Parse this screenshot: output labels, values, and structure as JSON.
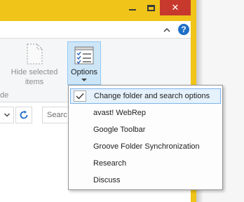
{
  "window": {
    "close_glyph": "✕"
  },
  "ribbon": {
    "help_glyph": "?",
    "hide_selected_label": "Hide selected items",
    "group_label": "de",
    "options_label": "Options"
  },
  "address_bar": {
    "search_placeholder": "Searc"
  },
  "menu": {
    "items": [
      {
        "label": "Change folder and search options",
        "checked": true,
        "selected": true
      },
      {
        "label": "avast! WebRep"
      },
      {
        "label": "Google Toolbar"
      },
      {
        "label": "Groove Folder Synchronization"
      },
      {
        "label": "Research"
      },
      {
        "label": "Discuss"
      }
    ]
  },
  "colors": {
    "frame": "#f0c419",
    "close_button": "#c7392c",
    "help": "#1e6fc6",
    "selection_border": "#7eb4ea",
    "selection_fill": "#e5f1fb"
  }
}
